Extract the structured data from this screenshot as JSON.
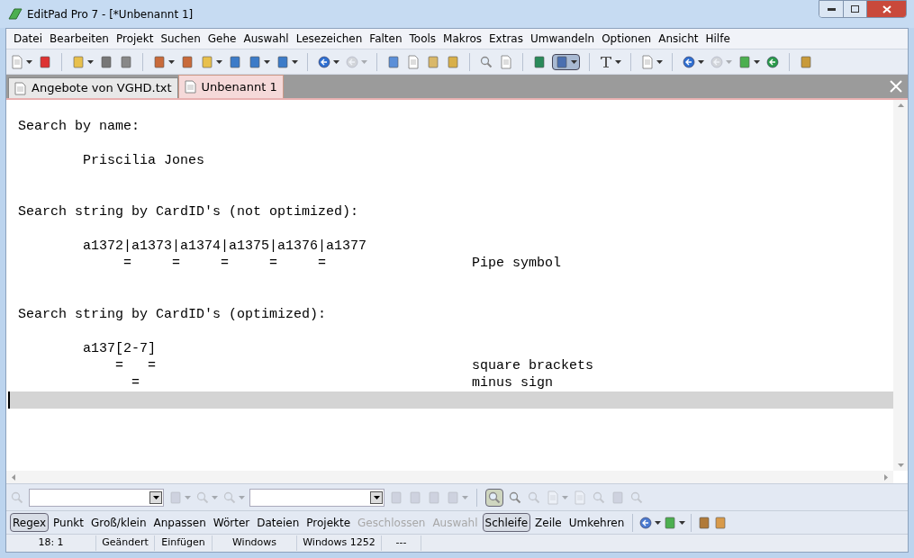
{
  "window": {
    "title": "EditPad Pro 7 - [*Unbenannt 1]"
  },
  "menu": [
    "Datei",
    "Bearbeiten",
    "Projekt",
    "Suchen",
    "Gehe",
    "Auswahl",
    "Lesezeichen",
    "Falten",
    "Tools",
    "Makros",
    "Extras",
    "Umwandeln",
    "Optionen",
    "Ansicht",
    "Hilfe"
  ],
  "tabs": [
    {
      "label": "Angebote von VGHD.txt",
      "selected": false
    },
    {
      "label": "Unbenannt 1",
      "selected": true
    }
  ],
  "editor": {
    "text": "\nSearch by name:\n\n        Priscilia Jones\n\n\nSearch string by CardID's (not optimized):\n\n        a1372|a1373|a1374|a1375|a1376|a1377\n             =     =     =     =     =                  Pipe symbol\n\n\nSearch string by CardID's (optimized):\n\n        a137[2-7]\n            =   =                                       square brackets\n              =                                         minus sign\n"
  },
  "toolbar": {
    "word_wrap_on": true,
    "highlight_on": true
  },
  "search_options": [
    {
      "label": "Regex",
      "on": true,
      "disabled": false
    },
    {
      "label": "Punkt",
      "on": false,
      "disabled": false
    },
    {
      "label": "Groß/klein",
      "on": false,
      "disabled": false
    },
    {
      "label": "Anpassen",
      "on": false,
      "disabled": false
    },
    {
      "label": "Wörter",
      "on": false,
      "disabled": false
    },
    {
      "label": "Dateien",
      "on": false,
      "disabled": false
    },
    {
      "label": "Projekte",
      "on": false,
      "disabled": false
    },
    {
      "label": "Geschlossen",
      "on": false,
      "disabled": true
    },
    {
      "label": "Auswahl",
      "on": false,
      "disabled": true
    },
    {
      "label": "Schleife",
      "on": true,
      "disabled": false
    },
    {
      "label": "Zeile",
      "on": false,
      "disabled": false
    },
    {
      "label": "Umkehren",
      "on": false,
      "disabled": false
    }
  ],
  "status_bar": [
    "18: 1",
    "Geändert",
    "Einfügen",
    "Windows",
    "Windows 1252",
    "---"
  ]
}
